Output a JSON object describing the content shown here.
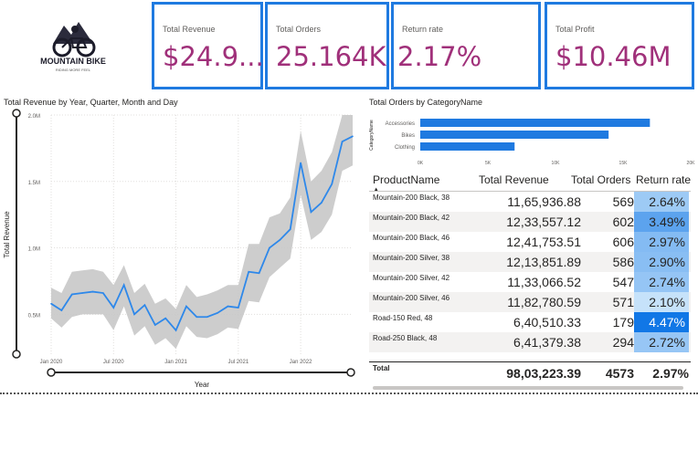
{
  "logo": {
    "title": "MOUNTAIN BIKE",
    "tagline": "RIDING MORE FEEL"
  },
  "kpis": [
    {
      "title": "Total Revenue",
      "value": "$24.9..."
    },
    {
      "title": "Total Orders",
      "value": "25.164K"
    },
    {
      "title": "Return rate",
      "value": "2.17%"
    },
    {
      "title": "Total Profit",
      "value": "$10.46M"
    }
  ],
  "colors": {
    "accent": "#1f7ae0",
    "kpi_value": "#a0307a",
    "line": "#2e88ea",
    "band": "#c8c8c8",
    "bar": "#1f7ae0"
  },
  "chart_data": [
    {
      "type": "line",
      "title": "Total Revenue by Year, Quarter, Month and Day",
      "xlabel": "Year",
      "ylabel": "Total Revenue",
      "yticks": [
        "0.5M",
        "1.0M",
        "1.5M",
        "2.0M"
      ],
      "xticks": [
        "Jan 2020",
        "Jul 2020",
        "Jan 2021",
        "Jul 2021",
        "Jan 2022"
      ],
      "ylim": [
        0.2,
        2.0
      ],
      "grid": true,
      "forecast_band": true,
      "series": [
        {
          "x": [
            "2020-01",
            "2020-02",
            "2020-03",
            "2020-04",
            "2020-05",
            "2020-06",
            "2020-07",
            "2020-08",
            "2020-09",
            "2020-10",
            "2020-11",
            "2020-12",
            "2021-01",
            "2021-02",
            "2021-03",
            "2021-04",
            "2021-05",
            "2021-06",
            "2021-07",
            "2021-08",
            "2021-09",
            "2021-10",
            "2021-11",
            "2021-12",
            "2022-01",
            "2022-02",
            "2022-03",
            "2022-04",
            "2022-05",
            "2022-06"
          ],
          "values": [
            0.58,
            0.53,
            0.65,
            0.66,
            0.67,
            0.66,
            0.55,
            0.72,
            0.5,
            0.57,
            0.42,
            0.47,
            0.38,
            0.56,
            0.48,
            0.48,
            0.51,
            0.56,
            0.55,
            0.82,
            0.81,
            1.0,
            1.06,
            1.14,
            1.64,
            1.27,
            1.34,
            1.48,
            1.8,
            1.84
          ],
          "upper": [
            0.7,
            0.66,
            0.82,
            0.83,
            0.84,
            0.82,
            0.72,
            0.87,
            0.66,
            0.73,
            0.58,
            0.62,
            0.54,
            0.72,
            0.63,
            0.65,
            0.68,
            0.72,
            0.72,
            1.03,
            1.03,
            1.23,
            1.26,
            1.38,
            1.88,
            1.5,
            1.58,
            1.72,
            2.0,
            2.0
          ],
          "lower": [
            0.47,
            0.4,
            0.48,
            0.5,
            0.5,
            0.5,
            0.38,
            0.56,
            0.34,
            0.41,
            0.27,
            0.32,
            0.24,
            0.41,
            0.33,
            0.32,
            0.35,
            0.4,
            0.39,
            0.6,
            0.59,
            0.78,
            0.85,
            0.92,
            1.4,
            1.06,
            1.12,
            1.25,
            1.58,
            1.62
          ]
        }
      ]
    },
    {
      "type": "bar",
      "orientation": "horizontal",
      "title": "Total Orders by CategoryName",
      "ylabel": "CategoryName",
      "categories": [
        "Accessories",
        "Bikes",
        "Clothing"
      ],
      "values": [
        16983,
        13929,
        6976
      ],
      "xticks": [
        "0K",
        "5K",
        "10K",
        "15K",
        "20K"
      ],
      "xlim": [
        0,
        20000
      ]
    }
  ],
  "table": {
    "headers": [
      "ProductName",
      "Total Revenue",
      "Total Orders",
      "Return rate"
    ],
    "rows": [
      {
        "name": "Mountain-200 Black, 38",
        "revenue": "11,65,936.88",
        "orders": "569",
        "rate": "2.64%",
        "rate_value": 2.64
      },
      {
        "name": "Mountain-200 Black, 42",
        "revenue": "12,33,557.12",
        "orders": "602",
        "rate": "3.49%",
        "rate_value": 3.49
      },
      {
        "name": "Mountain-200 Black, 46",
        "revenue": "12,41,753.51",
        "orders": "606",
        "rate": "2.97%",
        "rate_value": 2.97
      },
      {
        "name": "Mountain-200 Silver, 38",
        "revenue": "12,13,851.89",
        "orders": "586",
        "rate": "2.90%",
        "rate_value": 2.9
      },
      {
        "name": "Mountain-200 Silver, 42",
        "revenue": "11,33,066.52",
        "orders": "547",
        "rate": "2.74%",
        "rate_value": 2.74
      },
      {
        "name": "Mountain-200 Silver, 46",
        "revenue": "11,82,780.59",
        "orders": "571",
        "rate": "2.10%",
        "rate_value": 2.1
      },
      {
        "name": "Road-150 Red, 48",
        "revenue": "6,40,510.33",
        "orders": "179",
        "rate": "4.47%",
        "rate_value": 4.47
      },
      {
        "name": "Road-250 Black, 48",
        "revenue": "6,41,379.38",
        "orders": "294",
        "rate": "2.72%",
        "rate_value": 2.72
      }
    ],
    "total": {
      "label": "Total",
      "revenue": "98,03,223.39",
      "orders": "4573",
      "rate": "2.97%"
    }
  }
}
